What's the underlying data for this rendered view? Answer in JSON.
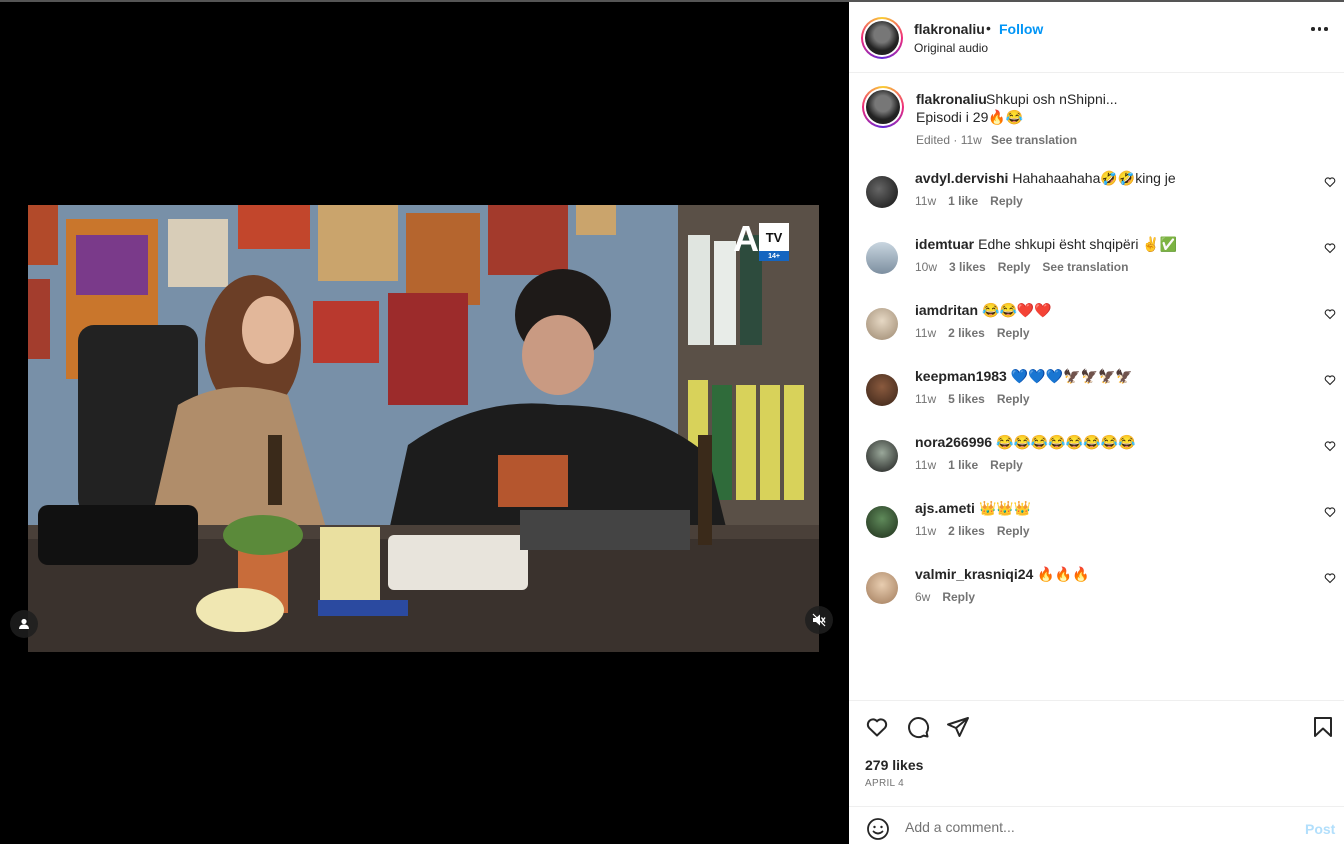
{
  "post": {
    "username": "flakronaliu",
    "follow_label": "Follow",
    "separator": "•",
    "audio": "Original audio",
    "caption_text": "Shkupi osh nShipni...",
    "caption_line2": "Episodi i 29🔥😂",
    "caption_meta": "Edited · 11w",
    "see_translation": "See translation"
  },
  "video": {
    "channel_logo": "ATV",
    "logo_letter": "A",
    "logo_tv": "TV",
    "age_rating": "14+",
    "tag_icon": "user-tag-icon",
    "mute_icon": "speaker-muted-icon"
  },
  "comments": [
    {
      "user": "avdyl.dervishi",
      "text": "Hahahaahaha🤣🤣king je",
      "time": "11w",
      "likes": "1 like",
      "reply": "Reply",
      "translate": "",
      "avatar_color": "#2b2b2b"
    },
    {
      "user": "idemtuar",
      "text": "Edhe shkupi ësht shqipëri ✌️✅",
      "time": "10w",
      "likes": "3 likes",
      "reply": "Reply",
      "translate": "See translation",
      "avatar_color": "#9fb4c7"
    },
    {
      "user": "iamdritan",
      "text": "😂😂❤️❤️",
      "time": "11w",
      "likes": "2 likes",
      "reply": "Reply",
      "translate": "",
      "avatar_color": "#c9b8a2"
    },
    {
      "user": "keepman1983",
      "text": "💙💙💙🦅🦅🦅🦅",
      "time": "11w",
      "likes": "5 likes",
      "reply": "Reply",
      "translate": "",
      "avatar_color": "#5a3d2e"
    },
    {
      "user": "nora266996",
      "text": "😂😂😂😂😂😂😂😂",
      "time": "11w",
      "likes": "1 like",
      "reply": "Reply",
      "translate": "",
      "avatar_color": "#3a3a3a"
    },
    {
      "user": "ajs.ameti",
      "text": "👑👑👑",
      "time": "11w",
      "likes": "2 likes",
      "reply": "Reply",
      "translate": "",
      "avatar_color": "#2f4a2a"
    },
    {
      "user": "valmir_krasniqi24",
      "text": "🔥🔥🔥",
      "time": "6w",
      "likes": "",
      "reply": "Reply",
      "translate": "",
      "avatar_color": "#caa98a"
    }
  ],
  "actions": {
    "likes": "279 likes",
    "date": "APRIL 4",
    "comment_placeholder": "Add a comment...",
    "post_label": "Post",
    "like_icon": "heart-icon",
    "comment_icon": "comment-bubble-icon",
    "share_icon": "paper-plane-icon",
    "save_icon": "bookmark-icon",
    "emoji_icon": "smiley-icon"
  },
  "colors": {
    "link_blue": "#0095f6",
    "post_disabled": "#b2dffc",
    "muted_text": "#737373"
  }
}
